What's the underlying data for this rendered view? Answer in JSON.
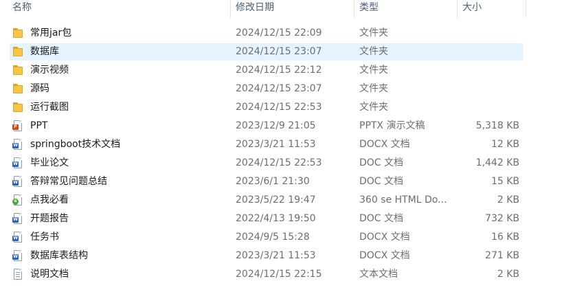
{
  "columns": {
    "name": "名称",
    "modified": "修改日期",
    "type": "类型",
    "size": "大小"
  },
  "files": [
    {
      "name": "常用jar包",
      "modified": "2024/12/15 22:09",
      "type": "文件夹",
      "size": "",
      "icon": "folder-icon"
    },
    {
      "name": "数据库",
      "modified": "2024/12/15 23:07",
      "type": "文件夹",
      "size": "",
      "icon": "folder-icon",
      "selected": true
    },
    {
      "name": "演示视频",
      "modified": "2024/12/15 22:12",
      "type": "文件夹",
      "size": "",
      "icon": "folder-icon"
    },
    {
      "name": "源码",
      "modified": "2024/12/15 23:07",
      "type": "文件夹",
      "size": "",
      "icon": "folder-icon"
    },
    {
      "name": "运行截图",
      "modified": "2024/12/15 22:53",
      "type": "文件夹",
      "size": "",
      "icon": "folder-icon"
    },
    {
      "name": "PPT",
      "modified": "2023/12/9 21:05",
      "type": "PPTX 演示文稿",
      "size": "5,318 KB",
      "icon": "powerpoint-file-icon"
    },
    {
      "name": "springboot技术文档",
      "modified": "2023/3/21 11:53",
      "type": "DOCX 文档",
      "size": "12 KB",
      "icon": "word-file-icon"
    },
    {
      "name": "毕业论文",
      "modified": "2024/12/15 22:53",
      "type": "DOC 文档",
      "size": "1,442 KB",
      "icon": "word-file-icon"
    },
    {
      "name": "答辩常见问题总结",
      "modified": "2023/6/1 21:30",
      "type": "DOC 文档",
      "size": "15 KB",
      "icon": "word-file-icon"
    },
    {
      "name": "点我必看",
      "modified": "2023/5/22 19:47",
      "type": "360 se HTML Do...",
      "size": "2 KB",
      "icon": "html-file-icon"
    },
    {
      "name": "开题报告",
      "modified": "2022/4/13 19:50",
      "type": "DOC 文档",
      "size": "732 KB",
      "icon": "word-file-icon"
    },
    {
      "name": "任务书",
      "modified": "2024/9/5 15:28",
      "type": "DOCX 文档",
      "size": "16 KB",
      "icon": "word-file-icon"
    },
    {
      "name": "数据库表结构",
      "modified": "2023/3/21 11:53",
      "type": "DOCX 文档",
      "size": "271 KB",
      "icon": "word-file-icon"
    },
    {
      "name": "说明文档",
      "modified": "2024/12/15 22:15",
      "type": "文本文档",
      "size": "2 KB",
      "icon": "text-file-icon"
    }
  ],
  "colors": {
    "header_text": "#4c607a",
    "selection": "#e5f3ff",
    "secondary_text": "#6d6d6d"
  }
}
